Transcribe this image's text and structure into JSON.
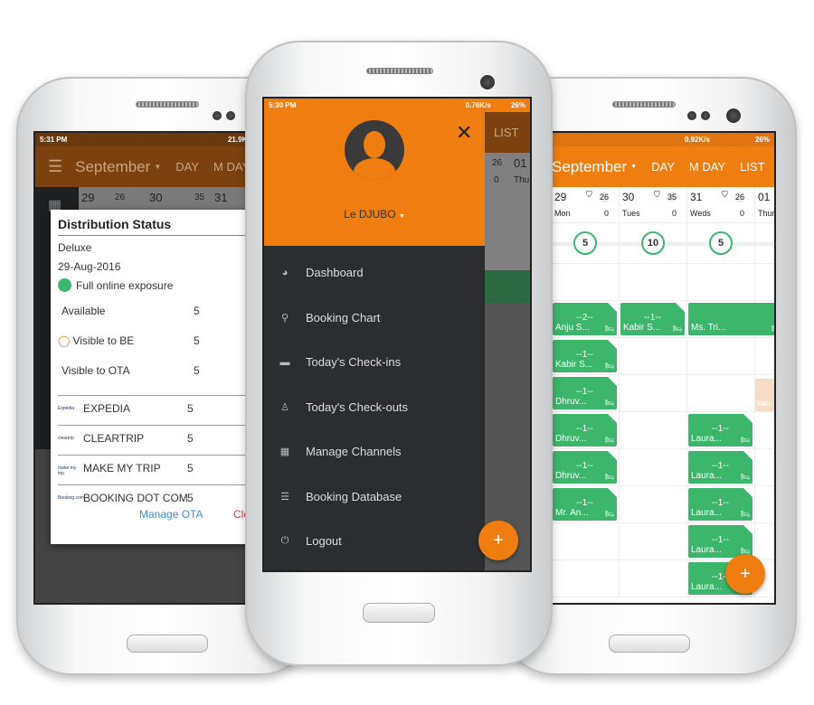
{
  "colors": {
    "accent": "#ef7d10",
    "booking": "#3cb66b",
    "drawer": "#2b2d30",
    "link": "#3b8fe0",
    "close": "#e53935"
  },
  "left_phone": {
    "status": {
      "time": "5:31 PM",
      "net": "21.9K/s"
    },
    "header": {
      "month": "September",
      "tabs": [
        "DAY",
        "M DAY"
      ]
    },
    "dates": [
      {
        "d": "29",
        "n": "26"
      },
      {
        "d": "30",
        "n": "35"
      },
      {
        "d": "31"
      }
    ],
    "dialog": {
      "title": "Distribution Status",
      "room": "Deluxe",
      "date": "29-Aug-2016",
      "exposure": "Full online exposure",
      "rows": [
        {
          "label": "Available",
          "value": "5"
        },
        {
          "label": "Visible to BE",
          "value": "5"
        },
        {
          "label": "Visible to OTA",
          "value": "5"
        }
      ],
      "otas": [
        {
          "logo": "Expedia",
          "label": "EXPEDIA",
          "value": "5"
        },
        {
          "logo": "cleartrip",
          "label": "CLEARTRIP",
          "value": "5"
        },
        {
          "logo": "make my trip",
          "label": "MAKE MY TRIP",
          "value": "5"
        },
        {
          "logo": "Booking.com",
          "label": "BOOKING DOT COM",
          "value": "5"
        }
      ],
      "manage": "Manage OTA",
      "close": "Clo"
    }
  },
  "center_phone": {
    "status": {
      "time": "5:30 PM",
      "net": "0.76K/s",
      "battery": "26%"
    },
    "user": "Le DJUBO",
    "menu": [
      {
        "icon": "dashboard-icon",
        "glyph": "◕",
        "label": "Dashboard"
      },
      {
        "icon": "pin-icon",
        "glyph": "⚲",
        "label": "Booking Chart"
      },
      {
        "icon": "bed-icon",
        "glyph": "▬",
        "label": "Today's Check-ins"
      },
      {
        "icon": "person-icon",
        "glyph": "♙",
        "label": "Today's Check-outs"
      },
      {
        "icon": "grid-icon",
        "glyph": "▦",
        "label": "Manage Channels"
      },
      {
        "icon": "database-icon",
        "glyph": "☰",
        "label": "Booking Database"
      },
      {
        "icon": "power-icon",
        "glyph": "⏻",
        "label": "Logout"
      }
    ],
    "behind": {
      "tab": "LIST",
      "n": "26",
      "d": "01",
      "z": "0",
      "day": "Thu"
    },
    "fab": "+"
  },
  "right_phone": {
    "status": {
      "net": "0.92K/s",
      "battery": "26%"
    },
    "header": {
      "month": "September",
      "tabs": [
        "DAY",
        "M DAY",
        "LIST"
      ]
    },
    "days": [
      {
        "d": "29",
        "n": "26",
        "w": "Mon",
        "z": "0",
        "c": "5"
      },
      {
        "d": "30",
        "n": "35",
        "w": "Tues",
        "z": "0",
        "c": "10"
      },
      {
        "d": "31",
        "n": "26",
        "w": "Weds",
        "z": "0",
        "c": "5"
      },
      {
        "d": "01",
        "w": "Thur"
      }
    ],
    "bookings": [
      {
        "col": 0,
        "row": 0,
        "count": "--2--",
        "guest": "Anju S..."
      },
      {
        "col": 1,
        "row": 0,
        "count": "--1--",
        "guest": "Kabir S..."
      },
      {
        "col": 2,
        "row": 0,
        "count": "",
        "guest": "Ms. Tri..."
      },
      {
        "col": 0,
        "row": 1,
        "count": "--1--",
        "guest": "Kabir S..."
      },
      {
        "col": 0,
        "row": 2,
        "count": "--1--",
        "guest": "Dhruv..."
      },
      {
        "col": 0,
        "row": 3,
        "count": "--1--",
        "guest": "Dhruv..."
      },
      {
        "col": 2,
        "row": 3,
        "count": "--1--",
        "guest": "Laura..."
      },
      {
        "col": 0,
        "row": 4,
        "count": "--1--",
        "guest": "Dhruv..."
      },
      {
        "col": 2,
        "row": 4,
        "count": "--1--",
        "guest": "Laura..."
      },
      {
        "col": 0,
        "row": 5,
        "count": "--1--",
        "guest": "Mr. An..."
      },
      {
        "col": 2,
        "row": 5,
        "count": "--1--",
        "guest": "Laura..."
      },
      {
        "col": 2,
        "row": 6,
        "count": "--1--",
        "guest": "Laura..."
      },
      {
        "col": 2,
        "row": 7,
        "count": "--1--",
        "guest": "Laura..."
      }
    ],
    "peach": "kau",
    "fab": "+"
  }
}
